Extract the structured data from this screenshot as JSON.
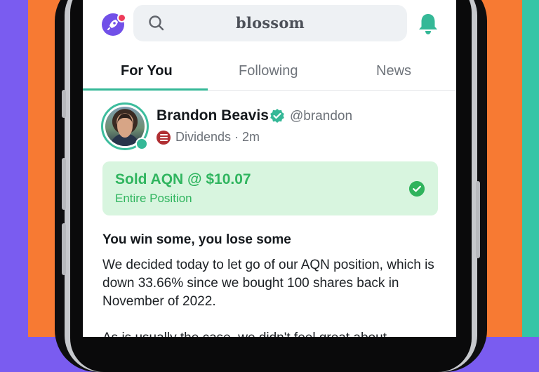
{
  "colors": {
    "brand": "#7150e8",
    "accent": "#35b897",
    "success": "#30b55f",
    "success_bg": "#d8f5df",
    "category": "#b02f33",
    "backdrop_orange": "#f77a33",
    "backdrop_purple": "#7a5cf0",
    "backdrop_teal": "#35c5a6"
  },
  "header": {
    "logo_icon": "rocket-icon",
    "search_icon": "search-icon",
    "search_text": "blossom",
    "notification_icon": "bell-icon"
  },
  "tabs": [
    {
      "label": "For You",
      "active": true
    },
    {
      "label": "Following",
      "active": false
    },
    {
      "label": "News",
      "active": false
    }
  ],
  "post": {
    "author": {
      "name": "Brandon Beavis",
      "verified_icon": "verified-check-icon",
      "handle": "@brandon"
    },
    "category_icon": "coin-stack-icon",
    "meta": "Dividends · 2m",
    "trade": {
      "title": "Sold AQN @ $10.07",
      "subtitle": "Entire Position",
      "status_icon": "check-circle-icon"
    },
    "title": "You win some, you lose some",
    "paragraphs": [
      "We decided today to let go of our AQN position, which is down 33.66% since we bought 100 shares back in November of 2022.",
      "As is usually the case, we didn't feel great about"
    ]
  }
}
